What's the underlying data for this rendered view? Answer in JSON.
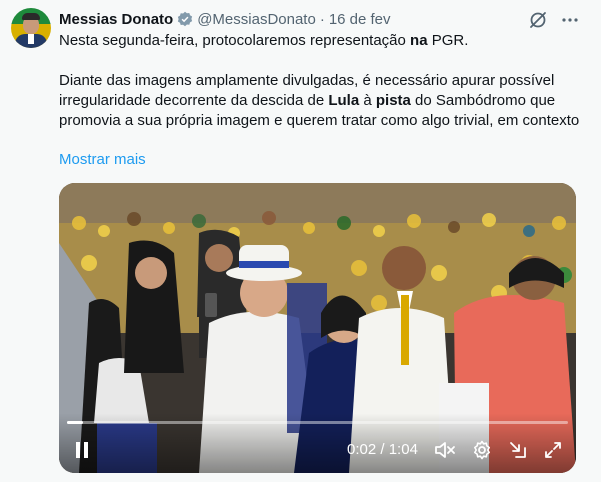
{
  "tweet": {
    "author_name": "Messias Donato",
    "handle": "@MessiasDonato",
    "separator": "·",
    "date": "16 de fev",
    "line1_a": "Nesta segunda-feira, protocolaremos representação ",
    "line1_b": "na",
    "line1_c": " PGR.",
    "para2_a": "Diante das imagens amplamente divulgadas, é necessário apurar possível irregularidade decorrente da descida de ",
    "para2_b": "Lula",
    "para2_c": " à ",
    "para2_d": "pista",
    "para2_e": " do Sambódromo que promovia a sua própria imagem e querem tratar como algo trivial, em contexto",
    "show_more": "Mostrar mais"
  },
  "video": {
    "current_time": "0:02",
    "duration": "1:04",
    "time_separator": " / ",
    "progress": 0.031
  },
  "icons": {
    "verified": "verified-badge-icon",
    "grok": "grok-icon",
    "more": "more-options-icon",
    "pause": "pause-icon",
    "mute": "volume-muted-icon",
    "settings": "settings-icon",
    "dock": "dock-icon",
    "fullscreen": "fullscreen-icon"
  },
  "colors": {
    "accent": "#1d9bf0",
    "text": "#0f1419",
    "muted": "#536471",
    "background": "#f7f9f9"
  }
}
